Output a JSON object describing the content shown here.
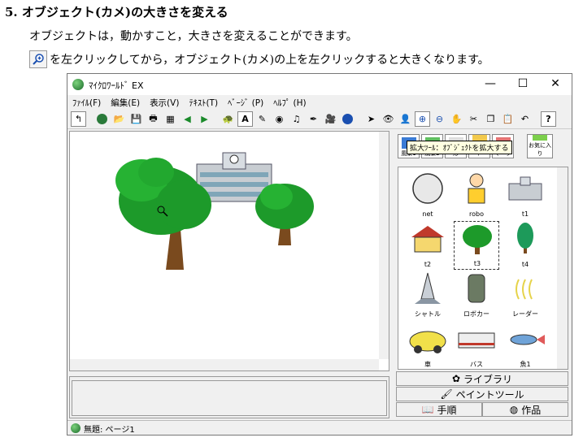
{
  "doc": {
    "heading": "5. オブジェクト(カメ)の大きさを変える",
    "line1": "オブジェクトは，動かすこと，大きさを変えることができます。",
    "line2": "を左クリックしてから，オブジェクト(カメ)の上を左クリックすると大きくなります。"
  },
  "window": {
    "title": "ﾏｲｸﾛﾜｰﾙﾄﾞ EX",
    "minimize": "—",
    "maximize": "☐",
    "close": "✕"
  },
  "menu": [
    "ﾌｧｲﾙ(F)",
    "編集(E)",
    "表示(V)",
    "ﾃｷｽﾄ(T)",
    "ﾍﾞｰｼﾞ (P)",
    "ﾍﾙﾌﾟ (H)"
  ],
  "tooltip": "拡大ﾂｰﾙ：ｵﾌﾞｼﾞｪｸﾄを拡大する",
  "categories": [
    "風景1",
    "風景2",
    "形",
    "イラスト",
    "マーク",
    "お気に入り"
  ],
  "library": [
    {
      "label": "net"
    },
    {
      "label": "robo"
    },
    {
      "label": "t1"
    },
    {
      "label": "t2"
    },
    {
      "label": "t3"
    },
    {
      "label": "t4"
    },
    {
      "label": "シャトル"
    },
    {
      "label": "ロボカー"
    },
    {
      "label": "レーダー"
    },
    {
      "label": "車"
    },
    {
      "label": "バス"
    },
    {
      "label": "魚1"
    }
  ],
  "panel_buttons": {
    "library": "ライブラリ",
    "paint": "ペイントツール",
    "manual": "手順",
    "works": "作品"
  },
  "status": "無題: ページ1",
  "colors": {
    "tree_green": "#1d9a2a",
    "trunk": "#7a4a1e",
    "tooltip_bg": "#ffffe1"
  }
}
